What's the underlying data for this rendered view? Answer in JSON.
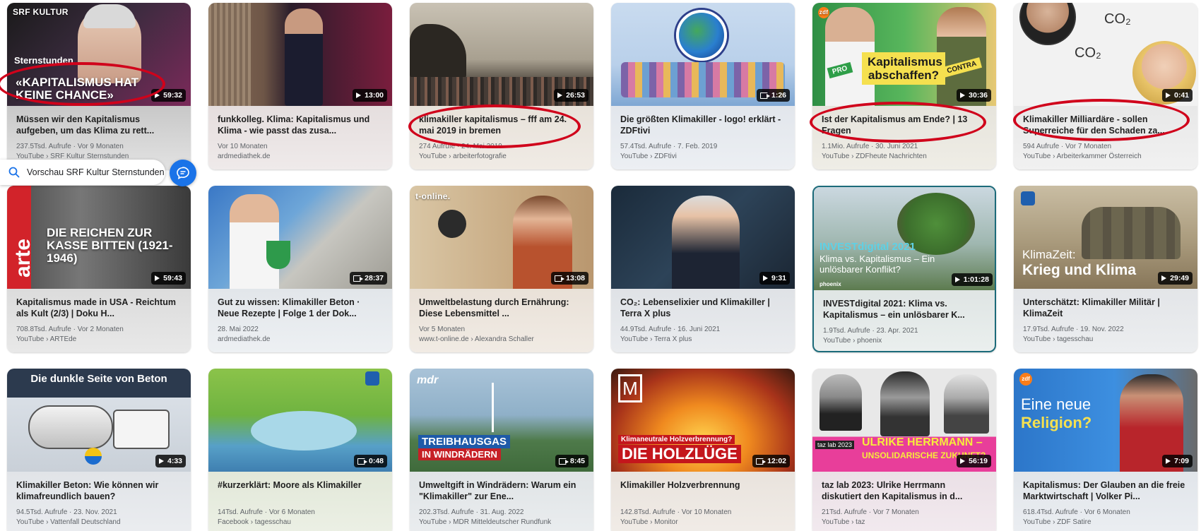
{
  "preview": {
    "label": "Vorschau SRF Kultur Sternstunden",
    "icon": "search-icon",
    "chat_icon": "chat-bubble-icon"
  },
  "cards": [
    {
      "title": "Müssen wir den Kapitalismus aufgeben, um das Klima zu rett...",
      "meta": "237.5Tsd. Aufrufe · Vor 9 Monaten",
      "source": "YouTube › SRF Kultur Sternstunden",
      "duration": "59:32",
      "badge": "play",
      "logo": "SRF KULTUR",
      "thumb_text": "«KAPITALISMUS HAT KEINE CHANCE»",
      "thumb_sub": "Sternstunden"
    },
    {
      "title": "funkkolleg. Klima: Kapitalismus und Klima - wie passt das zusa...",
      "meta": "Vor 10 Monaten",
      "source": "ardmediathek.de",
      "duration": "13:00",
      "badge": "play",
      "logo": "",
      "thumb_text": ""
    },
    {
      "title": "klimakiller kapitalismus – fff am 24. mai 2019 in bremen",
      "meta": "274 Aufrufe · 24. Mai 2019",
      "source": "YouTube › arbeiterfotografie",
      "duration": "26:53",
      "badge": "play",
      "logo": "",
      "thumb_text": ""
    },
    {
      "title": "Die größten Klimakiller - logo! erklärt - ZDFtivi",
      "meta": "57.4Tsd. Aufrufe · 7. Feb. 2019",
      "source": "YouTube › ZDFtivi",
      "duration": "1:26",
      "badge": "share",
      "logo": "",
      "thumb_text": ""
    },
    {
      "title": "Ist der Kapitalismus am Ende? | 13 Fragen",
      "meta": "1.1Mio. Aufrufe · 30. Juni 2021",
      "source": "YouTube › ZDFheute Nachrichten",
      "duration": "30:36",
      "badge": "play",
      "logo": "zdf",
      "thumb_text": "Kapitalismus abschaffen?",
      "pro": "PRO",
      "contra": "CONTRA"
    },
    {
      "title": "Klimakiller Milliardäre - sollen Superreiche für den Schaden za...",
      "meta": "594 Aufrufe · Vor 7 Monaten",
      "source": "YouTube › Arbeiterkammer Österreich",
      "duration": "0:41",
      "badge": "play",
      "logo": "",
      "thumb_text": "CO₂"
    },
    {
      "title": "Kapitalismus made in USA - Reichtum als Kult (2/3) | Doku H...",
      "meta": "708.8Tsd. Aufrufe · Vor 2 Monaten",
      "source": "YouTube › ARTEde",
      "duration": "59:43",
      "badge": "play",
      "logo": "arte",
      "thumb_text": "DIE REICHEN ZUR KASSE BITTEN (1921-1946)"
    },
    {
      "title": "Gut zu wissen: Klimakiller Beton · Neue Rezepte | Folge 1 der Dok...",
      "meta": "28. Mai 2022",
      "source": "ardmediathek.de",
      "duration": "28:37",
      "badge": "share",
      "logo": "",
      "thumb_text": ""
    },
    {
      "title": "Umweltbelastung durch Ernährung: Diese Lebensmittel ...",
      "meta": "Vor 5 Monaten",
      "source": "www.t-online.de › Alexandra Schaller",
      "duration": "13:08",
      "badge": "share",
      "logo": "t-online.",
      "thumb_text": ""
    },
    {
      "title": "CO₂: Lebenselixier und Klimakiller | Terra X plus",
      "meta": "44.9Tsd. Aufrufe · 16. Juni 2021",
      "source": "YouTube › Terra X plus",
      "duration": "9:31",
      "badge": "play",
      "logo": "",
      "thumb_text": ""
    },
    {
      "title": "INVESTdigital 2021: Klima vs. Kapitalismus – ein unlösbarer K...",
      "meta": "1.9Tsd. Aufrufe · 23. Apr. 2021",
      "source": "YouTube › phoenix",
      "duration": "1:01:28",
      "badge": "play",
      "logo": "phoenix",
      "thumb_text": "INVESTdigital 2021",
      "thumb_sub": "Klima vs. Kapitalismus – Ein unlösbarer Konflikt?"
    },
    {
      "title": "Unterschätzt: Klimakiller Militär | KlimaZeit",
      "meta": "17.9Tsd. Aufrufe · 19. Nov. 2022",
      "source": "YouTube › tagesschau",
      "duration": "29:49",
      "badge": "play",
      "logo": "",
      "thumb_text": "KlimaZeit:",
      "thumb_sub": "Krieg und Klima"
    },
    {
      "title": "Klimakiller Beton: Wie können wir klimafreundlich bauen?",
      "meta": "94.5Tsd. Aufrufe · 23. Nov. 2021",
      "source": "YouTube › Vattenfall Deutschland",
      "duration": "4:33",
      "badge": "play",
      "logo": "",
      "thumb_text": "Die dunkle Seite von Beton"
    },
    {
      "title": "#kurzerklärt: Moore als Klimakiller",
      "meta": "14Tsd. Aufrufe · Vor 6 Monaten",
      "source": "Facebook › tagesschau",
      "duration": "0:48",
      "badge": "share",
      "logo": "",
      "thumb_text": ""
    },
    {
      "title": "Umweltgift in Windrädern: Warum ein \"Klimakiller\" zur Ene...",
      "meta": "202.3Tsd. Aufrufe · 31. Aug. 2022",
      "source": "YouTube › MDR Mitteldeutscher Rundfunk",
      "duration": "8:45",
      "badge": "share",
      "logo": "mdr",
      "thumb_text": "TREIBHAUSGAS",
      "thumb_sub": "IN WINDRÄDERN"
    },
    {
      "title": "Klimakiller Holzverbrennung",
      "meta": "142.8Tsd. Aufrufe · Vor 10 Monaten",
      "source": "YouTube › Monitor",
      "duration": "12:02",
      "badge": "share",
      "logo": "M",
      "thumb_text": "DIE HOLZLÜGE",
      "thumb_sub": "Klimaneutrale Holzverbrennung?"
    },
    {
      "title": "taz lab 2023: Ulrike Herrmann diskutiert den Kapitalismus in d...",
      "meta": "21Tsd. Aufrufe · Vor 7 Monaten",
      "source": "YouTube › taz",
      "duration": "56:19",
      "badge": "play",
      "logo": "taz lab 2023",
      "thumb_text": "ULRIKE HERRMANN –",
      "thumb_sub": "UNSOLIDARISCHE ZUKUNFT?"
    },
    {
      "title": "Kapitalismus: Der Glauben an die freie Marktwirtschaft | Volker Pi...",
      "meta": "618.4Tsd. Aufrufe · Vor 6 Monaten",
      "source": "YouTube › ZDF Satire",
      "duration": "7:09",
      "badge": "play",
      "logo": "zdf",
      "thumb_text": "Eine neue",
      "thumb_sub": "Religion?"
    }
  ]
}
